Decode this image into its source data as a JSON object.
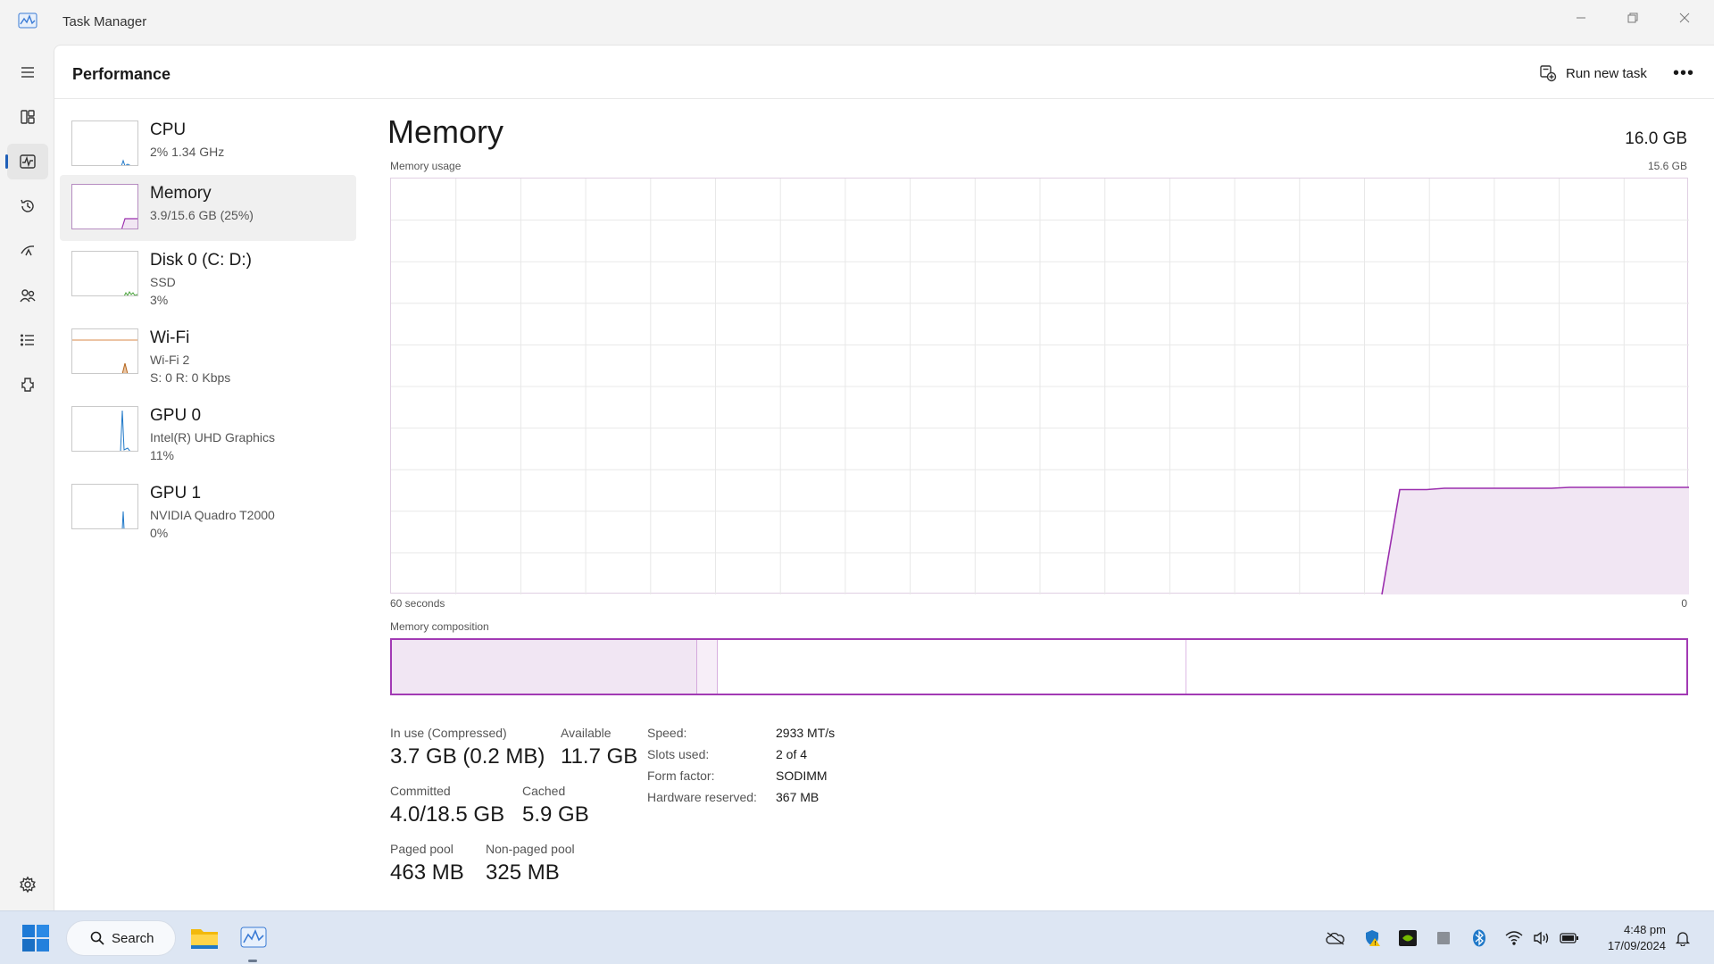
{
  "window": {
    "title": "Task Manager"
  },
  "header": {
    "title": "Performance",
    "run_new_task": "Run new task",
    "more": "•••"
  },
  "rail": [
    "menu-icon",
    "processes-icon",
    "performance-icon",
    "app-history-icon",
    "startup-apps-icon",
    "users-icon",
    "details-icon",
    "services-icon",
    "settings-icon"
  ],
  "devices": [
    {
      "name": "CPU",
      "line1": "2%  1.34 GHz",
      "line2": "",
      "color": "#1f78c8"
    },
    {
      "name": "Memory",
      "line1": "3.9/15.6 GB (25%)",
      "line2": "",
      "color": "#9b2fae"
    },
    {
      "name": "Disk 0 (C: D:)",
      "line1": "SSD",
      "line2": "3%",
      "color": "#4aa33c"
    },
    {
      "name": "Wi-Fi",
      "line1": "Wi-Fi 2",
      "line2": "S: 0  R: 0 Kbps",
      "color": "#b5651d"
    },
    {
      "name": "GPU 0",
      "line1": "Intel(R) UHD Graphics",
      "line2": "11%",
      "color": "#1f78c8"
    },
    {
      "name": "GPU 1",
      "line1": "NVIDIA Quadro T2000",
      "line2": "0%",
      "color": "#1f78c8"
    }
  ],
  "memory": {
    "title": "Memory",
    "total": "16.0 GB",
    "usage_label": "Memory usage",
    "usage_max": "15.6 GB",
    "axis_left": "60 seconds",
    "axis_right": "0",
    "composition_label": "Memory composition",
    "usage_fraction": 0.25,
    "composition": {
      "in_use": 0.236,
      "modified": 0.016,
      "standby": 0.362,
      "free": 0.386
    },
    "stats": {
      "in_use_label": "In use (Compressed)",
      "in_use_value": "3.7 GB (0.2 MB)",
      "available_label": "Available",
      "available_value": "11.7 GB",
      "committed_label": "Committed",
      "committed_value": "4.0/18.5 GB",
      "cached_label": "Cached",
      "cached_value": "5.9 GB",
      "paged_label": "Paged pool",
      "paged_value": "463 MB",
      "nonpaged_label": "Non-paged pool",
      "nonpaged_value": "325 MB"
    },
    "props": [
      {
        "label": "Speed:",
        "value": "2933 MT/s"
      },
      {
        "label": "Slots used:",
        "value": "2 of 4"
      },
      {
        "label": "Form factor:",
        "value": "SODIMM"
      },
      {
        "label": "Hardware reserved:",
        "value": "367 MB"
      }
    ]
  },
  "taskbar": {
    "search": "Search",
    "time": "4:48 pm",
    "date": "17/09/2024"
  },
  "colors": {
    "accent": "#9b2fae",
    "accent_fill": "#f1e6f3",
    "graph_grid": "#e8e8e8"
  }
}
